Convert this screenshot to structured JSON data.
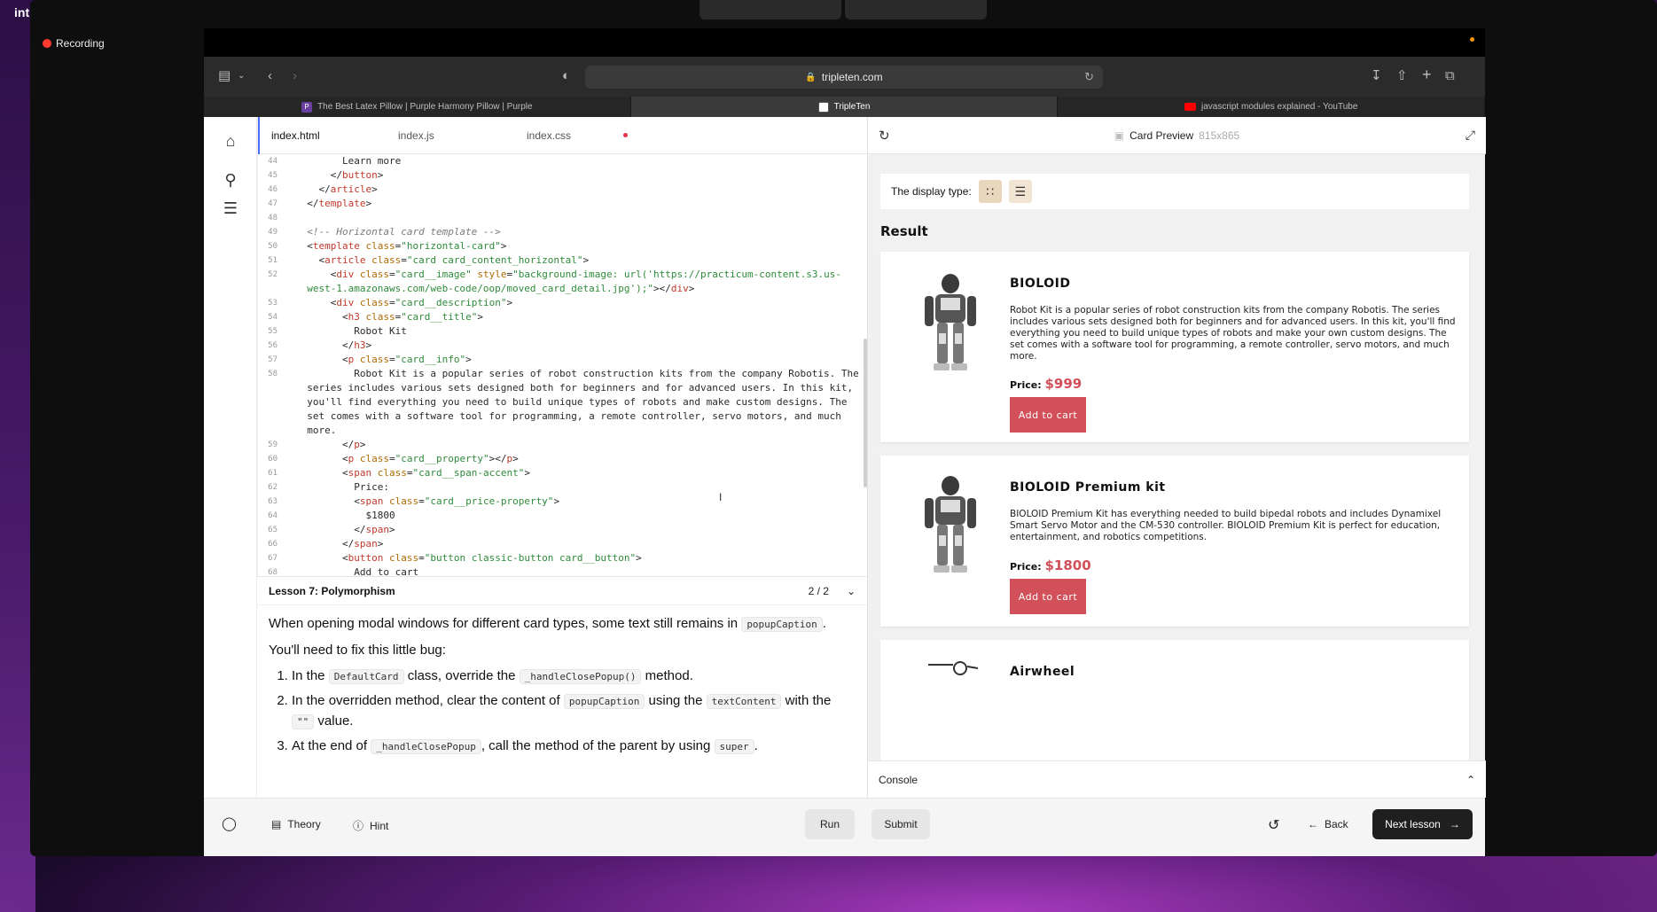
{
  "desktop": {
    "corner_label": "int",
    "recording_label": "Recording"
  },
  "browser": {
    "url": "tripleten.com",
    "tabs": [
      {
        "label": "The Best Latex Pillow | Purple Harmony Pillow | Purple",
        "favicon": "P"
      },
      {
        "label": "TripleTen",
        "favicon": "tripleten-icon"
      },
      {
        "label": "javascript modules explained - YouTube",
        "favicon": "youtube-icon"
      }
    ]
  },
  "editor": {
    "file_tabs": [
      "index.html",
      "index.js",
      "index.css"
    ],
    "active_tab": "index.html",
    "lines": [
      {
        "n": "44",
        "html": "        Learn more"
      },
      {
        "n": "45",
        "html": "      &lt;/<span class='tag'>button</span>&gt;"
      },
      {
        "n": "46",
        "html": "    &lt;/<span class='tag'>article</span>&gt;"
      },
      {
        "n": "47",
        "html": "  &lt;/<span class='tag'>template</span>&gt;"
      },
      {
        "n": "48",
        "html": ""
      },
      {
        "n": "49",
        "html": "  <span class='cmt'>&lt;!-- Horizontal card template --&gt;</span>"
      },
      {
        "n": "50",
        "html": "  &lt;<span class='tag'>template</span> <span class='attr'>class</span>=<span class='str'>\"horizontal-card\"</span>&gt;"
      },
      {
        "n": "51",
        "html": "    &lt;<span class='tag'>article</span> <span class='attr'>class</span>=<span class='str'>\"card card_content_horizontal\"</span>&gt;"
      },
      {
        "n": "52",
        "html": "      &lt;<span class='tag'>div</span> <span class='attr'>class</span>=<span class='str'>\"card__image\"</span> <span class='attr'>style</span>=<span class='str'>\"background-image: url('https://practicum-content.s3.us-</span>"
      },
      {
        "n": "",
        "html": "<span class='str'>  west-1.amazonaws.com/web-code/oop/moved_card_detail.jpg');\"</span>&gt;&lt;/<span class='tag'>div</span>&gt;"
      },
      {
        "n": "53",
        "html": "      &lt;<span class='tag'>div</span> <span class='attr'>class</span>=<span class='str'>\"card__description\"</span>&gt;"
      },
      {
        "n": "54",
        "html": "        &lt;<span class='tag'>h3</span> <span class='attr'>class</span>=<span class='str'>\"card__title\"</span>&gt;"
      },
      {
        "n": "55",
        "html": "          Robot Kit"
      },
      {
        "n": "56",
        "html": "        &lt;/<span class='tag'>h3</span>&gt;"
      },
      {
        "n": "57",
        "html": "        &lt;<span class='tag'>p</span> <span class='attr'>class</span>=<span class='str'>\"card__info\"</span>&gt;"
      },
      {
        "n": "58",
        "html": "          Robot Kit is a popular series of robot construction kits from the company Robotis. The"
      },
      {
        "n": "",
        "html": "  series includes various sets designed both for beginners and for advanced users. In this kit,"
      },
      {
        "n": "",
        "html": "  you'll find everything you need to build unique types of robots and make custom designs. The"
      },
      {
        "n": "",
        "html": "  set comes with a software tool for programming, a remote controller, servo motors, and much"
      },
      {
        "n": "",
        "html": "  more."
      },
      {
        "n": "59",
        "html": "        &lt;/<span class='tag'>p</span>&gt;"
      },
      {
        "n": "60",
        "html": "        &lt;<span class='tag'>p</span> <span class='attr'>class</span>=<span class='str'>\"card__property\"</span>&gt;&lt;/<span class='tag'>p</span>&gt;"
      },
      {
        "n": "61",
        "html": "        &lt;<span class='tag'>span</span> <span class='attr'>class</span>=<span class='str'>\"card__span-accent\"</span>&gt;"
      },
      {
        "n": "62",
        "html": "          Price:"
      },
      {
        "n": "63",
        "html": "          &lt;<span class='tag'>span</span> <span class='attr'>class</span>=<span class='str'>\"card__price-property\"</span>&gt;"
      },
      {
        "n": "64",
        "html": "            $1800"
      },
      {
        "n": "65",
        "html": "          &lt;/<span class='tag'>span</span>&gt;"
      },
      {
        "n": "66",
        "html": "        &lt;/<span class='tag'>span</span>&gt;"
      },
      {
        "n": "67",
        "html": "        &lt;<span class='tag'>button</span> <span class='attr'>class</span>=<span class='str'>\"button classic-button card__button\"</span>&gt;"
      },
      {
        "n": "68",
        "html": "          Add to cart"
      }
    ]
  },
  "lesson": {
    "title": "Lesson 7: Polymorphism",
    "page": "2 / 2",
    "intro_before": "When opening modal windows for different card types, some text still remains in",
    "intro_code": "popupCaption",
    "intro_after": ".",
    "bug_line": "You'll need to fix this little bug:",
    "steps": [
      {
        "a": "In the",
        "c1": "DefaultCard",
        "b": "class, override the",
        "c2": "_handleClosePopup()",
        "d": "method."
      },
      {
        "a": "In the overridden method, clear the content of",
        "c1": "popupCaption",
        "b": "using the",
        "c2": "textContent",
        "d": "with the",
        "c3": "\"\"",
        "e": "value."
      },
      {
        "a": "At the end of",
        "c1": "_handleClosePopup",
        "b": ", call the method of the parent by using",
        "c2": "super",
        "d": "."
      }
    ]
  },
  "preview": {
    "title": "Card Preview",
    "dimensions": "815x865",
    "display_type_label": "The display type:",
    "result_label": "Result",
    "cards": [
      {
        "title": "BIOLOID",
        "info": "Robot Kit is a popular series of robot construction kits from the company Robotis. The series includes various sets designed both for beginners and for advanced users. In this kit, you'll find everything you need to build unique types of robots and make your own custom designs. The set comes with a software tool for programming, a remote controller, servo motors, and much more.",
        "price_label": "Price:",
        "price": "$999",
        "button": "Add to cart"
      },
      {
        "title": "BIOLOID Premium kit",
        "info": "BIOLOID Premium Kit has everything needed to build bipedal robots and includes Dynamixel Smart Servo Motor and the CM-530 controller. BIOLOID Premium Kit is perfect for education, entertainment, and robotics competitions.",
        "price_label": "Price:",
        "price": "$1800",
        "button": "Add to cart"
      },
      {
        "title": "Airwheel"
      }
    ],
    "console_label": "Console"
  },
  "bottom_bar": {
    "theory": "Theory",
    "hint": "Hint",
    "run": "Run",
    "submit": "Submit",
    "back": "Back",
    "next": "Next lesson"
  },
  "colors": {
    "accent_red": "#d1505a",
    "active_tab_border": "#4a6cf7",
    "next_button_bg": "#1f1f1f"
  }
}
